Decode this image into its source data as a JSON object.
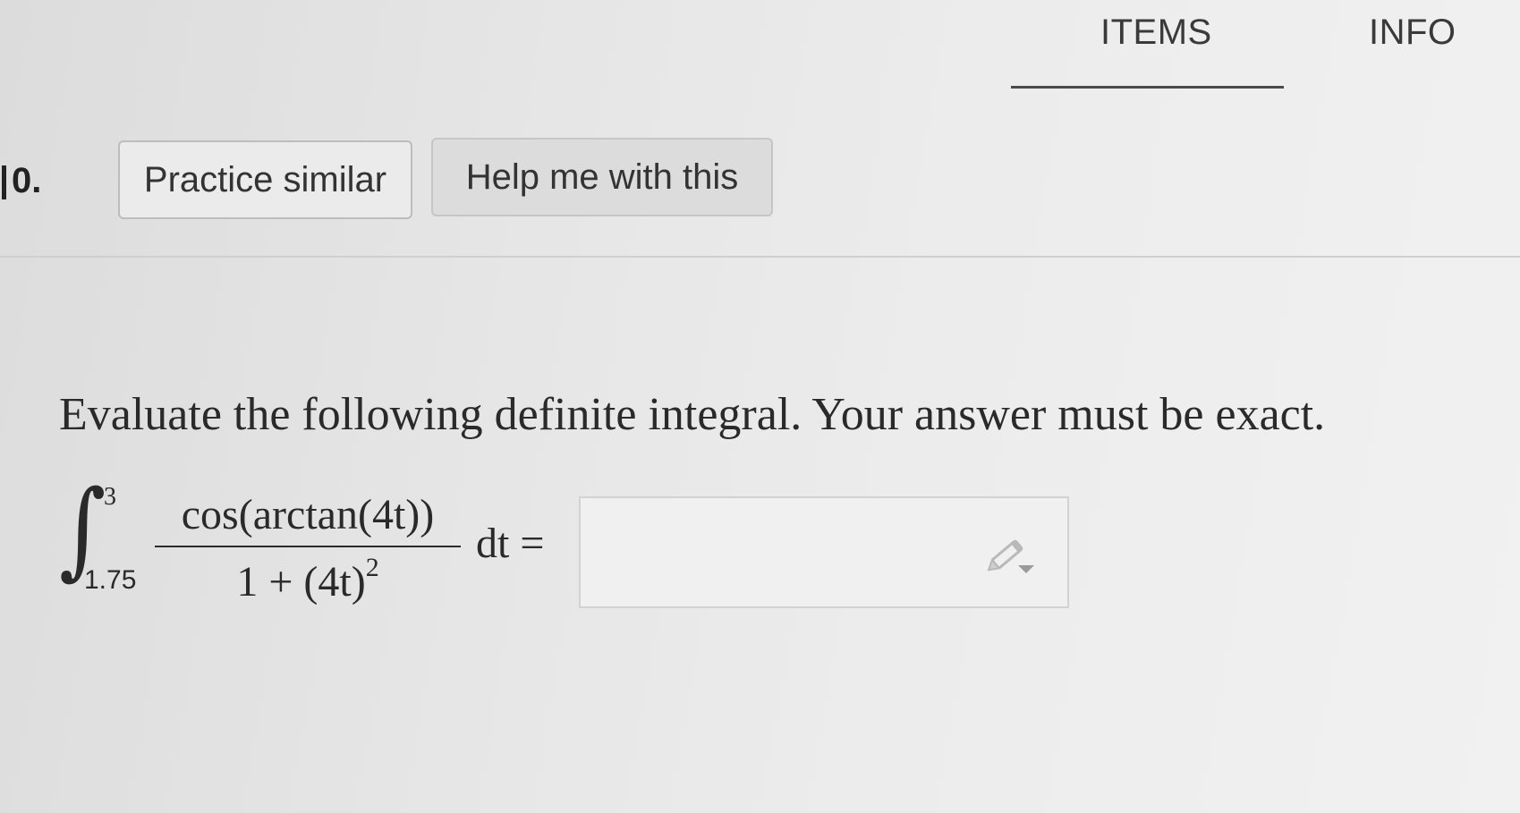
{
  "tabs": {
    "items_label": "ITEMS",
    "info_label": "INFO",
    "active": "ITEMS"
  },
  "question": {
    "number": "0.",
    "practice_label": "Practice similar",
    "help_label": "Help me with this",
    "prompt": "Evaluate the following definite integral. Your answer must be exact.",
    "integral": {
      "upper_limit": "3",
      "lower_limit": "1.75",
      "numerator": "cos(arctan(4t))",
      "denominator_base": "1 + (4t)",
      "denominator_exp": "2",
      "differential": "dt ="
    },
    "answer": {
      "value": "",
      "placeholder": ""
    }
  },
  "icons": {
    "answer_tool": "pencil-icon"
  }
}
